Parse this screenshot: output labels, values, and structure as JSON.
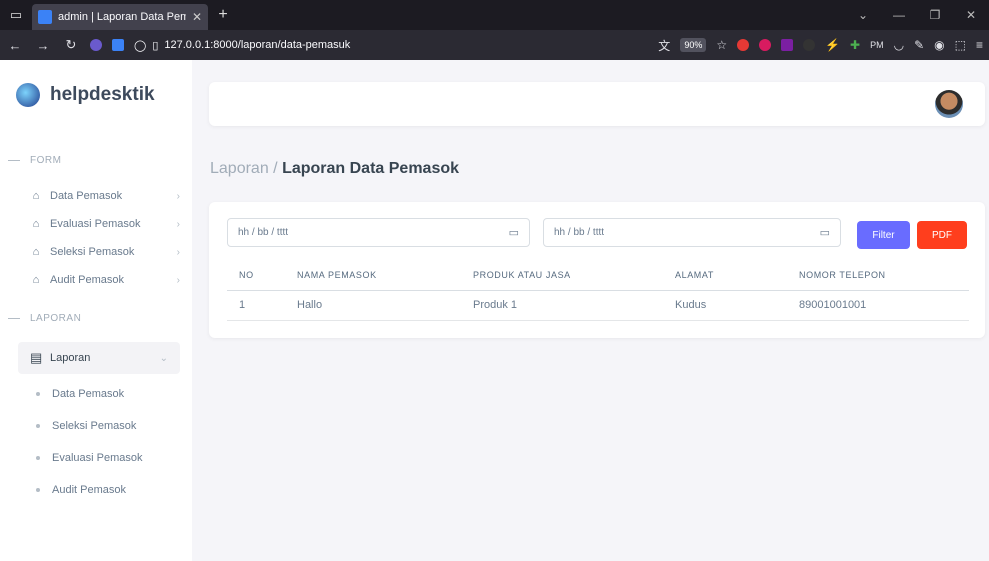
{
  "browser": {
    "tab_title": "admin | Laporan Data Pemasok",
    "url": "127.0.0.1:8000/laporan/data-pemasuk",
    "zoom": "90%",
    "ext_pm": "PM"
  },
  "brand": {
    "name": "helpdesktik"
  },
  "sidebar": {
    "form_header": "FORM",
    "form_items": [
      {
        "label": "Data Pemasok"
      },
      {
        "label": "Evaluasi Pemasok"
      },
      {
        "label": "Seleksi Pemasok"
      },
      {
        "label": "Audit Pemasok"
      }
    ],
    "laporan_header": "LAPORAN",
    "laporan_item": "Laporan",
    "laporan_sub": [
      {
        "label": "Data Pemasok"
      },
      {
        "label": "Seleksi Pemasok"
      },
      {
        "label": "Evaluasi Pemasok"
      },
      {
        "label": "Audit Pemasok"
      }
    ]
  },
  "breadcrumb": {
    "parent": "Laporan / ",
    "current": "Laporan Data Pemasok"
  },
  "filter": {
    "start_date_placeholder": "hh / bb / tttt",
    "end_date_placeholder": "hh / bb / tttt",
    "filter_label": "Filter",
    "pdf_label": "PDF",
    "filter_color": "#696cff",
    "pdf_color": "#ff3e1d"
  },
  "table": {
    "headers": [
      "NO",
      "NAMA PEMASOK",
      "PRODUK ATAU JASA",
      "ALAMAT",
      "NOMOR TELEPON"
    ],
    "rows": [
      [
        "1",
        "Hallo",
        "Produk 1",
        "Kudus",
        "89001001001"
      ]
    ]
  }
}
